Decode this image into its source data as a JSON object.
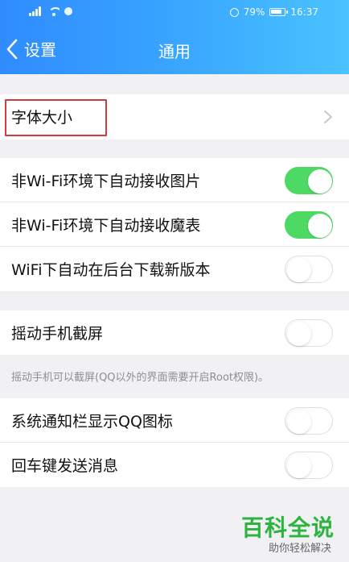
{
  "status_bar": {
    "battery_percent": "79%",
    "time": "16:37"
  },
  "navbar": {
    "back_label": "设置",
    "title": "通用"
  },
  "settings": {
    "font_size": {
      "label": "字体大小"
    },
    "auto_receive": [
      {
        "label": "非Wi-Fi环境下自动接收图片",
        "enabled": true
      },
      {
        "label": "非Wi-Fi环境下自动接收魔表",
        "enabled": true
      },
      {
        "label": "WiFi下自动在后台下载新版本",
        "enabled": false
      }
    ],
    "shake": {
      "label": "摇动手机截屏",
      "enabled": false,
      "note": "摇动手机可以截屏(QQ以外的界面需要开启Root权限)。"
    },
    "misc": [
      {
        "label": "系统通知栏显示QQ图标",
        "enabled": false
      },
      {
        "label": "回车键发送消息",
        "enabled": false
      }
    ]
  },
  "watermark": {
    "title": "百科全说",
    "subtitle": "助你轻松解决"
  },
  "colors": {
    "header_gradient_start": "#2f8cff",
    "header_gradient_end": "#4ac3ff",
    "toggle_on": "#4cd964",
    "highlight": "#d23b3b",
    "watermark_green": "#2db33f"
  }
}
